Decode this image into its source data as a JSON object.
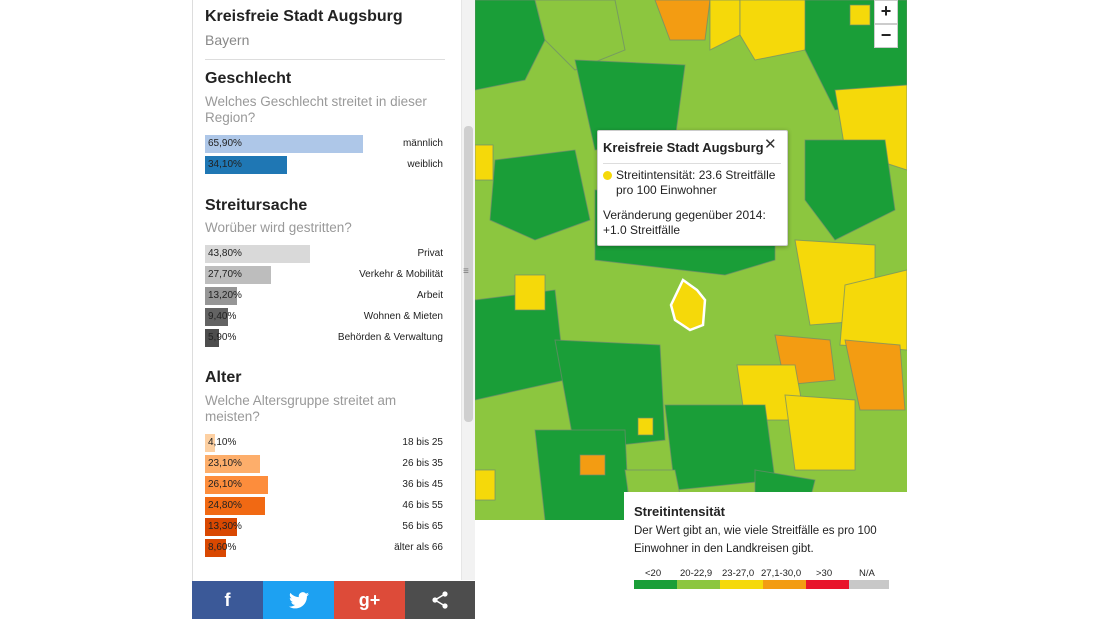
{
  "panel": {
    "title": "Kreisfreie Stadt Augsburg",
    "subtitle": "Bayern",
    "close_icon": "close-icon",
    "sections": [
      {
        "title": "Geschlecht",
        "question": "Welches Geschlecht streitet in dieser Region?",
        "rows": [
          {
            "pct": "65,90%",
            "label": "männlich",
            "value": 65.9,
            "color": "#aec7e8"
          },
          {
            "pct": "34,10%",
            "label": "weiblich",
            "value": 34.1,
            "color": "#1f77b4"
          }
        ]
      },
      {
        "title": "Streitursache",
        "question": "Worüber wird gestritten?",
        "rows": [
          {
            "pct": "43,80%",
            "label": "Privat",
            "value": 43.8,
            "color": "#d9d9d9"
          },
          {
            "pct": "27,70%",
            "label": "Verkehr & Mobilität",
            "value": 27.7,
            "color": "#bdbdbd"
          },
          {
            "pct": "13,20%",
            "label": "Arbeit",
            "value": 13.2,
            "color": "#969696"
          },
          {
            "pct": "9,40%",
            "label": "Wohnen & Mieten",
            "value": 9.4,
            "color": "#636363"
          },
          {
            "pct": "5,90%",
            "label": "Behörden & Verwaltung",
            "value": 5.9,
            "color": "#4d4d4d"
          }
        ]
      },
      {
        "title": "Alter",
        "question": "Welche Altersgruppe streitet am meisten?",
        "rows": [
          {
            "pct": "4,10%",
            "label": "18 bis 25",
            "value": 4.1,
            "color": "#fdd0a2"
          },
          {
            "pct": "23,10%",
            "label": "26 bis 35",
            "value": 23.1,
            "color": "#fdae6b"
          },
          {
            "pct": "26,10%",
            "label": "36 bis 45",
            "value": 26.1,
            "color": "#fd8d3c"
          },
          {
            "pct": "24,80%",
            "label": "46 bis 55",
            "value": 24.8,
            "color": "#f16913"
          },
          {
            "pct": "13,30%",
            "label": "56 bis 65",
            "value": 13.3,
            "color": "#d94801"
          },
          {
            "pct": "8,60%",
            "label": "älter als 66",
            "value": 8.6,
            "color": "#d94801"
          }
        ]
      }
    ]
  },
  "share": [
    {
      "label": "f",
      "icon": "facebook-icon",
      "color": "#3b5998"
    },
    {
      "label": "t",
      "icon": "twitter-icon",
      "color": "#1da1f2"
    },
    {
      "label": "g+",
      "icon": "google-plus-icon",
      "color": "#dd4b39"
    },
    {
      "label": "share",
      "icon": "share-icon",
      "color": "#4d4d4d"
    }
  ],
  "zoom": {
    "in": "+",
    "out": "−"
  },
  "popup": {
    "title": "Kreisfreie Stadt Augsburg",
    "close": "✕",
    "line1": "Streitintensität: 23.6 Streitfälle pro 100 Einwohner",
    "line2": "Veränderung gegenüber 2014: +1.0 Streitfälle",
    "dot_color": "#f5d90a"
  },
  "legend": {
    "title": "Streitintensität",
    "desc": "Der Wert gibt an, wie viele Streitfälle es pro 100 Einwohner in den Landkreisen gibt.",
    "items": [
      {
        "label": "<20",
        "color": "#1a9e38"
      },
      {
        "label": "20-22,9",
        "color": "#8cc63f"
      },
      {
        "label": "23-27,0",
        "color": "#f5d90a"
      },
      {
        "label": "27,1-30,0",
        "color": "#f39c12"
      },
      {
        "label": ">30",
        "color": "#e8142b"
      },
      {
        "label": "N/A",
        "color": "#c8c8c8"
      }
    ]
  }
}
